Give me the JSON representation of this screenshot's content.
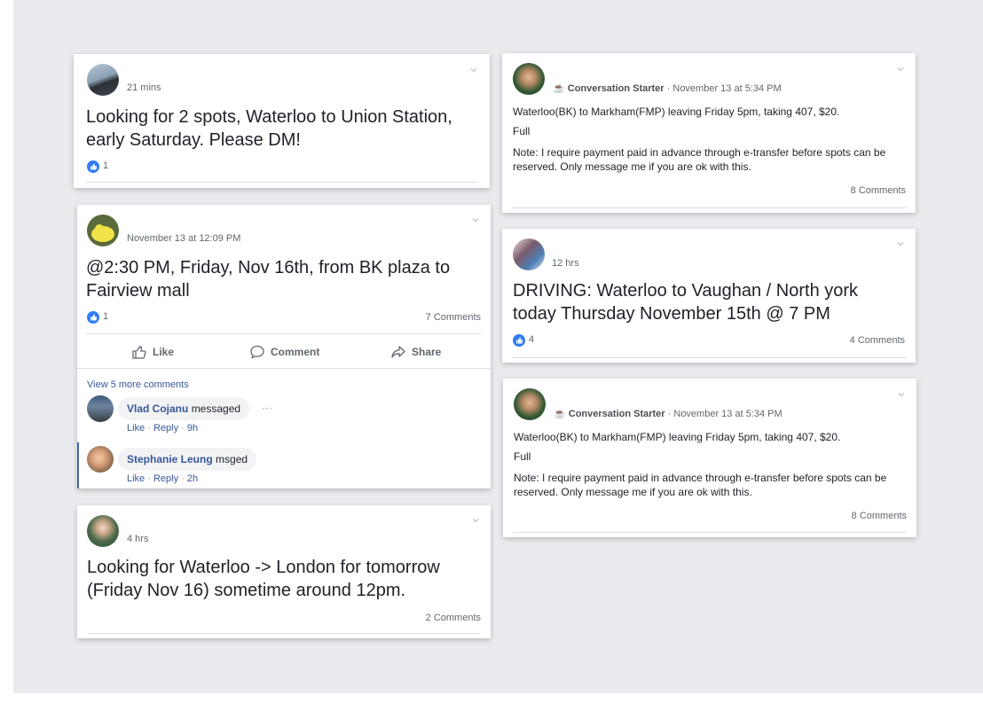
{
  "cards": [
    {
      "time": "21 mins",
      "text": "Looking for 2 spots, Waterloo to Union Station, early Saturday. Please DM!",
      "likes": "1"
    },
    {
      "time": "November 13 at 12:09 PM",
      "text": "@2:30 PM, Friday, Nov 16th, from BK plaza to Fairview mall",
      "likes": "1",
      "comments": "7 Comments",
      "actions": {
        "like": "Like",
        "comment": "Comment",
        "share": "Share"
      },
      "more": "View 5 more comments",
      "comment_list": [
        {
          "name": "Vlad Cojanu",
          "text": "messaged",
          "like": "Like",
          "reply": "Reply",
          "time": "9h"
        },
        {
          "name": "Stephanie Leung",
          "text": "msged",
          "like": "Like",
          "reply": "Reply",
          "time": "2h"
        }
      ]
    },
    {
      "time": "4 hrs",
      "text": "Looking for Waterloo -> London for tomorrow (Friday Nov 16) sometime around 12pm.",
      "comments": "2 Comments"
    },
    {
      "badge": "Conversation Starter",
      "time": "November 13 at 5:34 PM",
      "line1": "Waterloo(BK) to Markham(FMP) leaving Friday 5pm, taking 407, $20.",
      "line2": "Full",
      "line3": "Note: I require payment paid in advance through e-transfer before spots can be reserved. Only message me if you are ok with this.",
      "comments": "8 Comments"
    },
    {
      "time": "12 hrs",
      "text": "DRIVING: Waterloo to Vaughan / North york today Thursday November 15th @ 7 PM",
      "likes": "4",
      "comments": "4 Comments"
    },
    {
      "badge": "Conversation Starter",
      "time": "November 13 at 5:34 PM",
      "line1": "Waterloo(BK) to Markham(FMP) leaving Friday 5pm, taking 407, $20.",
      "line2": "Full",
      "line3": "Note: I require payment paid in advance through e-transfer before spots can be reserved. Only message me if you are ok with this.",
      "comments": "8 Comments"
    }
  ],
  "separators": {
    "dot": "·",
    "ellipsis": "···"
  },
  "colors": {
    "background": "#e9ebee",
    "like_blue": "#2f7cf6",
    "link": "#385898"
  }
}
